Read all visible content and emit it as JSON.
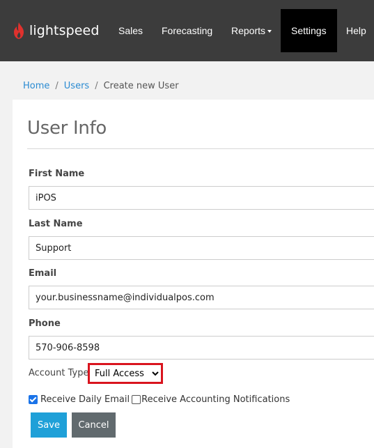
{
  "brand": {
    "name": "lightspeed",
    "logo_icon": "flame-icon",
    "color": "#e0312d"
  },
  "nav": {
    "items": [
      {
        "label": "Sales"
      },
      {
        "label": "Forecasting"
      },
      {
        "label": "Reports"
      },
      {
        "label": "Settings"
      },
      {
        "label": "Help"
      }
    ],
    "active": "Settings"
  },
  "breadcrumb": {
    "home": "Home",
    "users": "Users",
    "sep": "/",
    "current": "Create new User"
  },
  "form": {
    "title": "User Info",
    "first_name": {
      "label": "First Name",
      "value": "iPOS"
    },
    "last_name": {
      "label": "Last Name",
      "value": "Support"
    },
    "email": {
      "label": "Email",
      "value": "your.businessname@individualpos.com"
    },
    "phone": {
      "label": "Phone",
      "value": "570-906-8598"
    },
    "account_type": {
      "label": "Account Type",
      "value": "Full Access"
    },
    "receive_daily_email": {
      "label": "Receive Daily Email",
      "checked": true
    },
    "receive_accounting": {
      "label": "Receive Accounting Notifications",
      "checked": false
    },
    "save_label": "Save",
    "cancel_label": "Cancel"
  },
  "colors": {
    "link": "#2a8bd2",
    "save": "#1fa0d8",
    "cancel": "#616a6e",
    "highlight": "#d9141e",
    "navbar": "#3c3c3c"
  }
}
